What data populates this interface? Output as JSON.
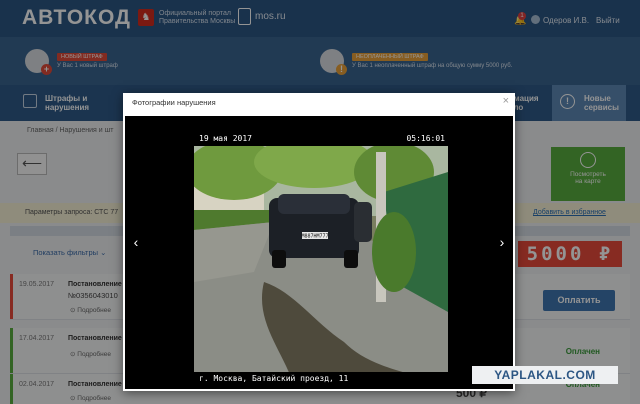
{
  "header": {
    "logo": "АВТОКОД",
    "portal_line1": "Официальный портал",
    "portal_line2": "Правительства Москвы",
    "mos": "mos.ru",
    "notif_count": "1",
    "user": "Одеров И.В.",
    "logout": "Выйти"
  },
  "alerts": {
    "new_fine_tag": "НОВЫЙ ШТРАФ",
    "new_fine_text": "У Вас 1 новый штраф",
    "unpaid_tag": "НЕОПЛАЧЕННЫЙ ШТРАФ",
    "unpaid_text": "У Вас 1 неоплаченный штраф на общую сумму 5000 руб."
  },
  "nav": {
    "fines_line1": "Штрафы и",
    "fines_line2": "нарушения",
    "info_line1": "рмация",
    "info_line2": "ело",
    "new_line1": "Новые",
    "new_line2": "сервисы"
  },
  "page": {
    "breadcrumb": "Главная  /  Нарушения и шт",
    "view_map_line1": "Посмотреть",
    "view_map_line2": "на карте",
    "params": "Параметры запроса: СТС 77",
    "add_fav": "Добавить в избранное",
    "show_filters": "Показать фильтры",
    "sum": "5000 ₽",
    "pay": "Оплатить",
    "partial_sum": "500 ₽"
  },
  "rows": [
    {
      "date": "19.05.2017",
      "title": "Постановление",
      "num": "№0356043010",
      "more": "Подробнее",
      "status": ""
    },
    {
      "date": "17.04.2017",
      "title": "Постановление",
      "num": "",
      "more": "Подробнее",
      "status": "Оплачен"
    },
    {
      "date": "02.04.2017",
      "title": "Постановление",
      "num": "",
      "more": "Подробнее",
      "status": "Оплачен"
    }
  ],
  "modal": {
    "title": "Фотографии нарушения",
    "close": "×",
    "prev": "‹",
    "next": "›",
    "photo_date": "19 мая 2017",
    "photo_time": "05:16:01",
    "photo_location": "г. Москва, Батайский проезд, 11",
    "plate": "М887НМ777"
  },
  "watermark": "YAPLAKAL.COM",
  "colors": {
    "header": "#2c5684",
    "alert_red": "#e94b3c",
    "map_green": "#58ad3f",
    "tag_orange": "#e8a13a"
  }
}
